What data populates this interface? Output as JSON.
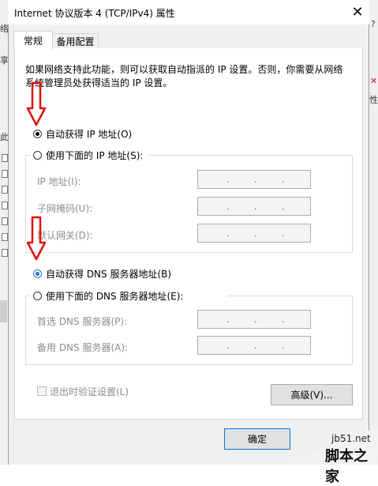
{
  "window": {
    "title": "Internet 协议版本 4 (TCP/IPv4) 属性",
    "close_glyph": "✕"
  },
  "tabs": [
    {
      "label": "常规",
      "active": true
    },
    {
      "label": "备用配置",
      "active": false
    }
  ],
  "description": "如果网络支持此功能，则可以获取自动指派的 IP 设置。否则，你需要从网络系统管理员处获得适当的 IP 设置。",
  "ip_section": {
    "auto_label": "自动获得 IP 地址(O)",
    "auto_selected": true,
    "manual_label": "使用下面的 IP 地址(S):",
    "fields": [
      {
        "label": "IP 地址(I):"
      },
      {
        "label": "子网掩码(U):"
      },
      {
        "label": "默认网关(D):"
      }
    ]
  },
  "dns_section": {
    "auto_label": "自动获得 DNS 服务器地址(B)",
    "auto_selected": true,
    "manual_label": "使用下面的 DNS 服务器地址(E):",
    "fields": [
      {
        "label": "首选 DNS 服务器(P):"
      },
      {
        "label": "备用 DNS 服务器(A):"
      }
    ]
  },
  "validate_checkbox_label": "退出时验证设置(L)",
  "advanced_button": "高级(V)...",
  "ok_button": "确定",
  "ip_dot": ".",
  "background_fragments": {
    "left": [
      "络",
      "享",
      "此"
    ],
    "right": [
      "?",
      "✕",
      "性"
    ]
  },
  "watermark": {
    "line1": "jb51.net",
    "line2": "脚本之家"
  },
  "colors": {
    "annotation_arrow": "#e01010",
    "selected_radio": "#2a6fd6",
    "right_sliver_mark": "#e01010"
  }
}
